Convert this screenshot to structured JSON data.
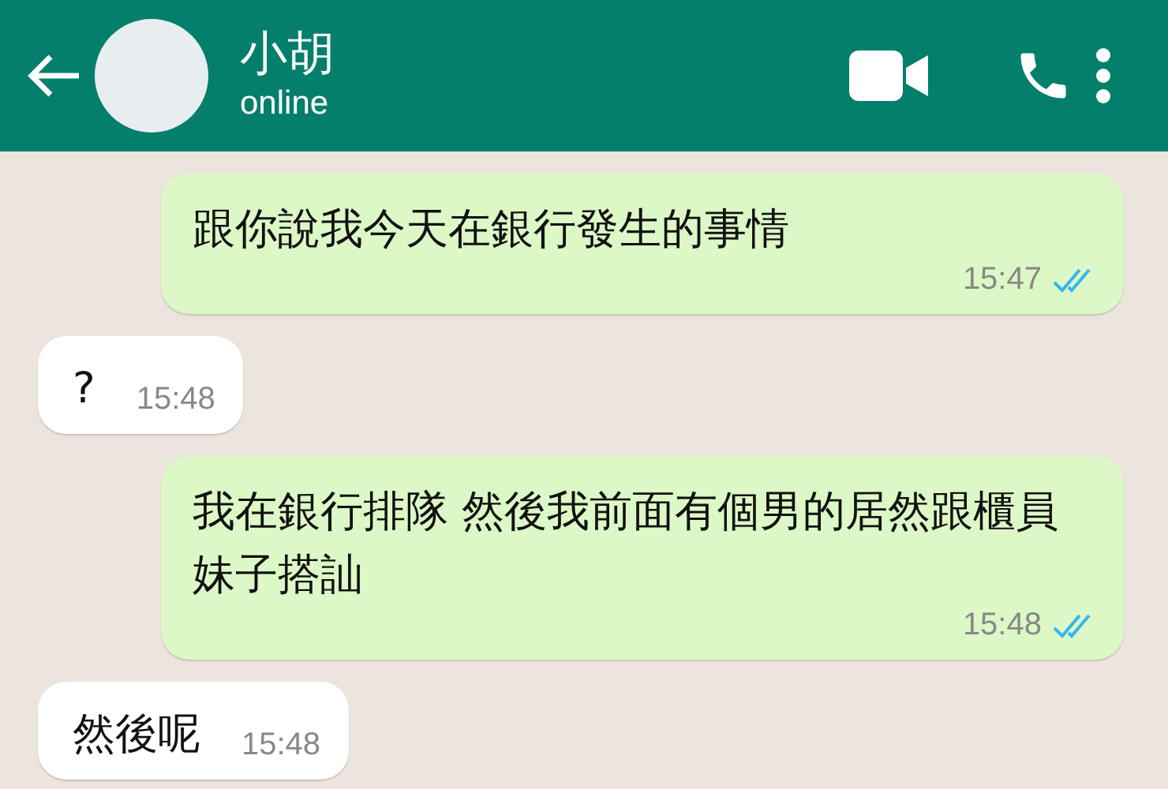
{
  "header": {
    "name": "小胡",
    "status": "online"
  },
  "messages": [
    {
      "kind": "outgoing",
      "text": "跟你說我今天在銀行發生的事情",
      "time": "15:47",
      "read": true
    },
    {
      "kind": "incoming",
      "text": "?",
      "time": "15:48"
    },
    {
      "kind": "outgoing",
      "text": "我在銀行排隊 然後我前面有個男的居然跟櫃員妹子搭訕",
      "time": "15:48",
      "read": true
    },
    {
      "kind": "incoming",
      "text": "然後呢",
      "time": "15:48"
    }
  ]
}
